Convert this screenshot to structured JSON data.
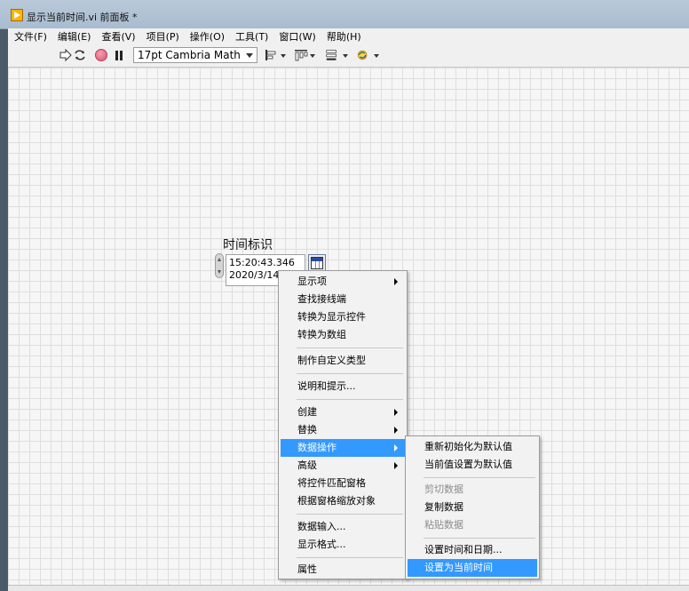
{
  "window": {
    "title": "显示当前时间.vi 前面板 *"
  },
  "menubar": [
    "文件(F)",
    "编辑(E)",
    "查看(V)",
    "项目(P)",
    "操作(O)",
    "工具(T)",
    "窗口(W)",
    "帮助(H)"
  ],
  "toolbar": {
    "font": "17pt Cambria Math"
  },
  "control": {
    "label": "时间标识",
    "time": "15:20:43.346",
    "date": "2020/3/14"
  },
  "context_menu": {
    "items": [
      "显示项",
      "查找接线端",
      "转换为显示控件",
      "转换为数组",
      "制作自定义类型",
      "说明和提示...",
      "创建",
      "替换",
      "数据操作",
      "高级",
      "将控件匹配窗格",
      "根据窗格缩放对象",
      "数据输入...",
      "显示格式...",
      "属性"
    ],
    "highlighted": "数据操作"
  },
  "submenu": {
    "items": [
      "重新初始化为默认值",
      "当前值设置为默认值",
      "剪切数据",
      "复制数据",
      "粘贴数据",
      "设置时间和日期...",
      "设置为当前时间"
    ],
    "highlighted": "设置为当前时间",
    "disabled": [
      "剪切数据",
      "粘贴数据"
    ]
  },
  "colors": {
    "highlight": "#3399ff",
    "titlebar": "#b9c9da"
  }
}
